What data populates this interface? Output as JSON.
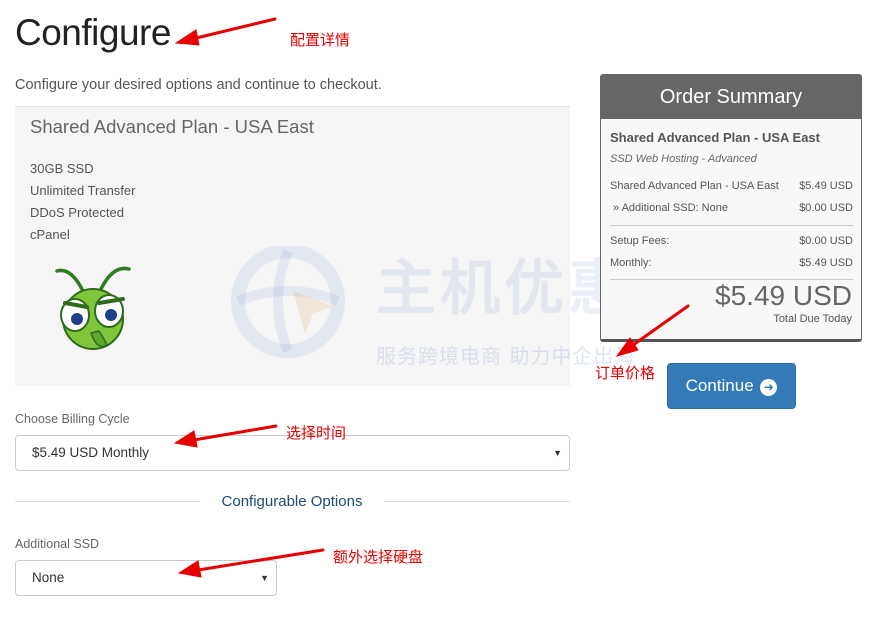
{
  "page": {
    "title": "Configure",
    "subtitle": "Configure your desired options and continue to checkout."
  },
  "product": {
    "name": "Shared Advanced Plan - USA East",
    "features": [
      "30GB SSD",
      "Unlimited Transfer",
      "DDoS Protected",
      "cPanel"
    ]
  },
  "watermark": {
    "big_text": "主机优惠",
    "small_text": "服务跨境电商 助力中企出海"
  },
  "billing": {
    "label": "Choose Billing Cycle",
    "selected": "$5.49 USD Monthly"
  },
  "options": {
    "section_title": "Configurable Options",
    "ssd_label": "Additional SSD",
    "ssd_selected": "None"
  },
  "summary": {
    "header": "Order Summary",
    "product": "Shared Advanced Plan - USA East",
    "group": "SSD Web Hosting - Advanced",
    "lines": [
      {
        "label": "Shared Advanced Plan - USA East",
        "amount": "$5.49 USD"
      },
      {
        "label": "» Additional SSD: None",
        "amount": "$0.00 USD"
      },
      {
        "label": "Setup Fees:",
        "amount": "$0.00 USD"
      },
      {
        "label": "Monthly:",
        "amount": "$5.49 USD"
      }
    ],
    "total": "$5.49 USD",
    "total_label": "Total Due Today"
  },
  "continue_button": {
    "label": "Continue",
    "icon": "arrow-circle-right-icon"
  },
  "annotations": {
    "title_note": "配置详情",
    "price_note": "订单价格",
    "billing_note": "选择时间",
    "ssd_note": "额外选择硬盘",
    "color": "#e60000"
  },
  "colors": {
    "accent": "#337ab7",
    "summary_header": "#666666",
    "section_title": "#1f4c72"
  }
}
